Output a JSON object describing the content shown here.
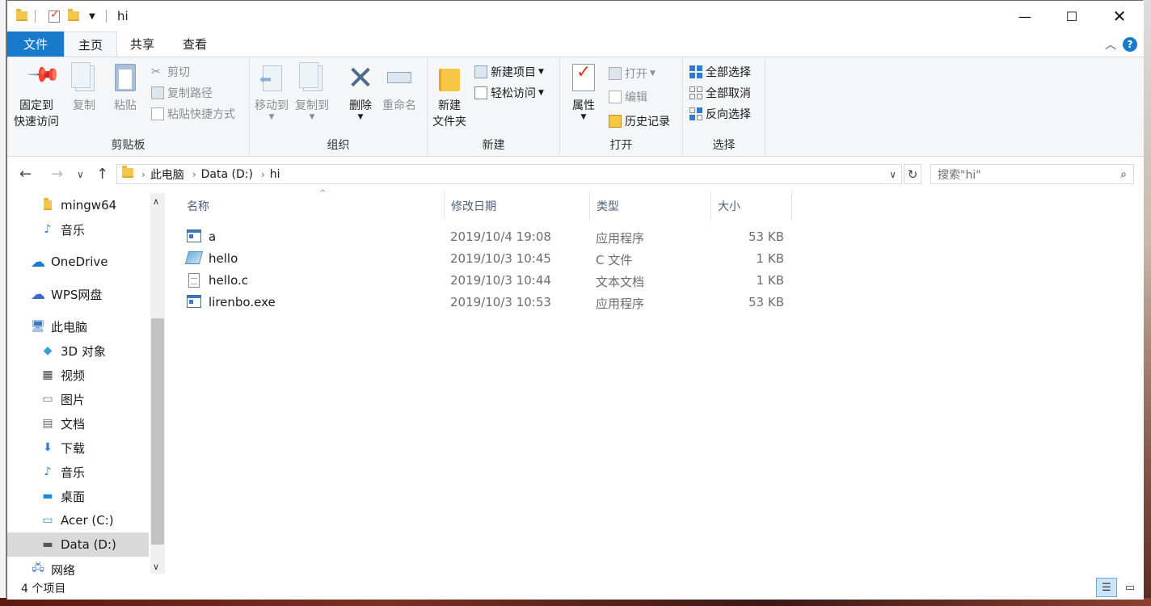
{
  "window": {
    "title": "hi"
  },
  "tabs": {
    "file": "文件",
    "home": "主页",
    "share": "共享",
    "view": "查看"
  },
  "ribbon": {
    "clipboard": {
      "label": "剪贴板",
      "pin_line1": "固定到",
      "pin_line2": "快速访问",
      "copy": "复制",
      "paste": "粘贴",
      "cut": "剪切",
      "copy_path": "复制路径",
      "paste_shortcut": "粘贴快捷方式"
    },
    "organize": {
      "label": "组织",
      "move_to": "移动到",
      "copy_to": "复制到",
      "delete": "删除",
      "rename": "重命名"
    },
    "new": {
      "label": "新建",
      "new_folder_line1": "新建",
      "new_folder_line2": "文件夹",
      "new_item": "新建项目",
      "easy_access": "轻松访问"
    },
    "open": {
      "label": "打开",
      "properties": "属性",
      "open": "打开",
      "edit": "编辑",
      "history": "历史记录"
    },
    "select": {
      "label": "选择",
      "select_all": "全部选择",
      "select_none": "全部取消",
      "invert": "反向选择"
    }
  },
  "address": {
    "crumbs": [
      "此电脑",
      "Data (D:)",
      "hi"
    ],
    "search_placeholder": "搜索\"hi\""
  },
  "nav": {
    "items": [
      {
        "label": "mingw64",
        "icon": "folder-icon"
      },
      {
        "label": "音乐",
        "icon": "music-icon"
      },
      {
        "label": "OneDrive",
        "icon": "onedrive-icon"
      },
      {
        "label": "WPS网盘",
        "icon": "cloud-icon"
      },
      {
        "label": "此电脑",
        "icon": "computer-icon"
      },
      {
        "label": "3D 对象",
        "icon": "cube-icon"
      },
      {
        "label": "视频",
        "icon": "video-icon"
      },
      {
        "label": "图片",
        "icon": "picture-icon"
      },
      {
        "label": "文档",
        "icon": "document-icon"
      },
      {
        "label": "下载",
        "icon": "download-icon"
      },
      {
        "label": "音乐",
        "icon": "music-icon"
      },
      {
        "label": "桌面",
        "icon": "desktop-icon"
      },
      {
        "label": "Acer (C:)",
        "icon": "drive-icon"
      },
      {
        "label": "Data (D:)",
        "icon": "drive-icon"
      },
      {
        "label": "网络",
        "icon": "network-icon"
      }
    ]
  },
  "columns": {
    "name": "名称",
    "date": "修改日期",
    "type": "类型",
    "size": "大小"
  },
  "files": [
    {
      "name": "a",
      "date": "2019/10/4 19:08",
      "type": "应用程序",
      "size": "53 KB",
      "icon": "app-icon"
    },
    {
      "name": "hello",
      "date": "2019/10/3 10:45",
      "type": "C 文件",
      "size": "1 KB",
      "icon": "c-file-icon"
    },
    {
      "name": "hello.c",
      "date": "2019/10/3 10:44",
      "type": "文本文档",
      "size": "1 KB",
      "icon": "text-file-icon"
    },
    {
      "name": "lirenbo.exe",
      "date": "2019/10/3 10:53",
      "type": "应用程序",
      "size": "53 KB",
      "icon": "app-icon"
    }
  ],
  "status": {
    "count": "4 个项目"
  },
  "colors": {
    "accent": "#1979ca",
    "selected_nav": "#d9d9d9"
  }
}
